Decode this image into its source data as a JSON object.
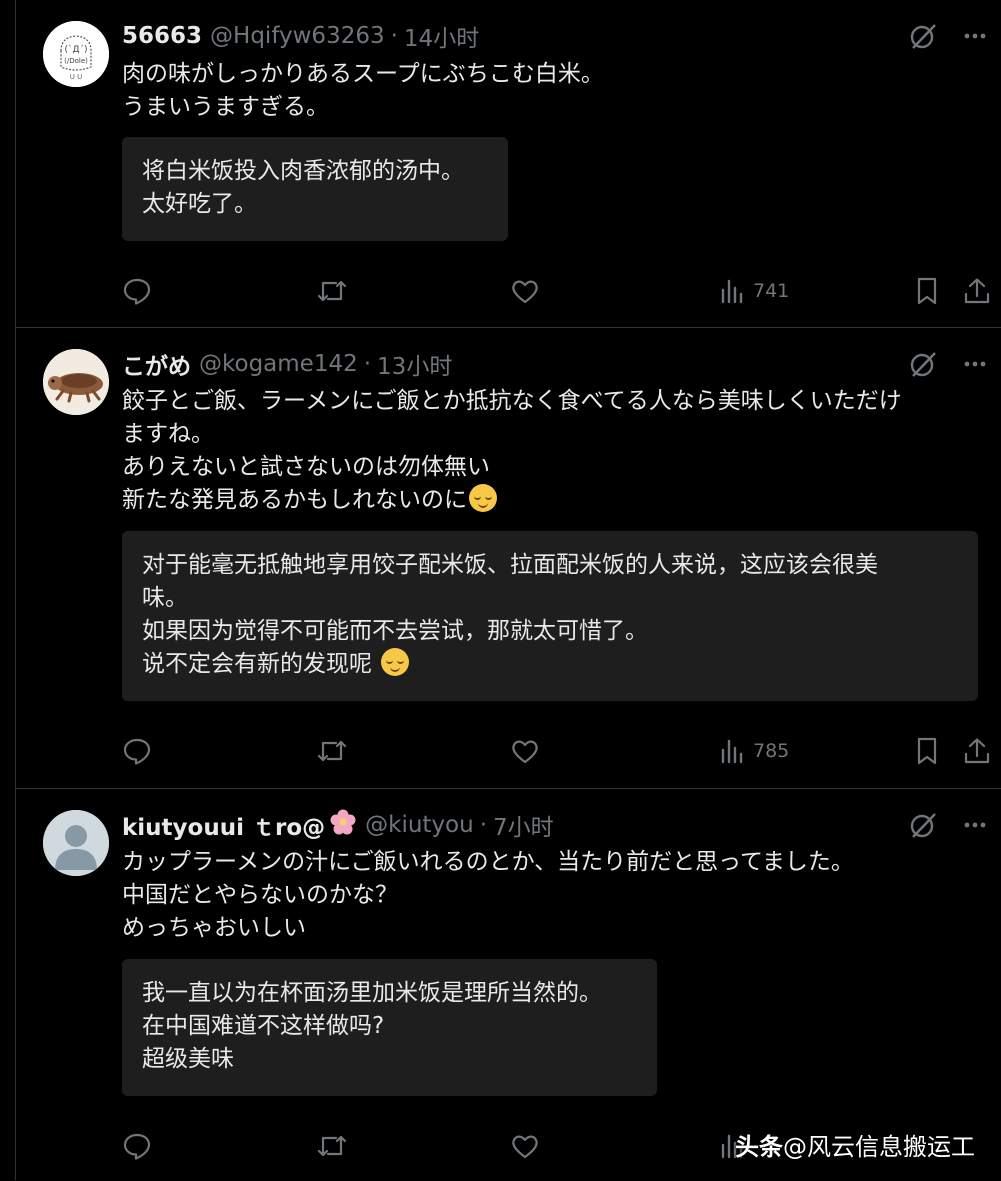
{
  "tweets": [
    {
      "name": "56663",
      "handle": "@Hqifyw63263",
      "time": "14小时",
      "text": [
        "肉の味がしっかりあるスープにぶちこむ白米。",
        "うまいうますぎる。"
      ],
      "translation": [
        "将白米饭投入肉香浓郁的汤中。",
        "太好吃了。"
      ],
      "views": "741"
    },
    {
      "name": "こがめ",
      "handle": "@kogame142",
      "time": "13小时",
      "text": [
        "餃子とご飯、ラーメンにご飯とか抵抗なく食べてる人なら美味しくいただけ",
        "ますね。",
        "ありえないと試さないのは勿体無い",
        "新たな発見あるかもしれないのに"
      ],
      "translation": [
        "对于能毫无抵触地享用饺子配米饭、拉面配米饭的人来说，这应该会很美",
        "味。",
        "如果因为觉得不可能而不去尝试，那就太可惜了。",
        "说不定会有新的发现呢"
      ],
      "views": "785"
    },
    {
      "name": "kiutyouui ｔro@",
      "handle": "@kiutyou",
      "time": "7小时",
      "text": [
        "カップラーメンの汁にご飯いれるのとか、当たり前だと思ってました。",
        "中国だとやらないのかな？",
        "めっちゃおいしい"
      ],
      "translation": [
        "我一直以为在杯面汤里加米饭是理所当然的。",
        "在中国难道不这样做吗?",
        "超级美味"
      ],
      "views": ""
    }
  ],
  "separator": "·",
  "watermark": {
    "brand": "头条",
    "text": "@风云信息搬运工"
  },
  "colors": {
    "background": "#000000",
    "text": "#e7e9ea",
    "muted": "#71767b",
    "card": "#1e1e1e",
    "emoji": "#f7c845"
  },
  "icons": [
    "grok-icon",
    "more-icon",
    "reply-icon",
    "retweet-icon",
    "like-icon",
    "views-icon",
    "bookmark-icon",
    "share-icon",
    "flower-emoji",
    "relieved-emoji"
  ]
}
